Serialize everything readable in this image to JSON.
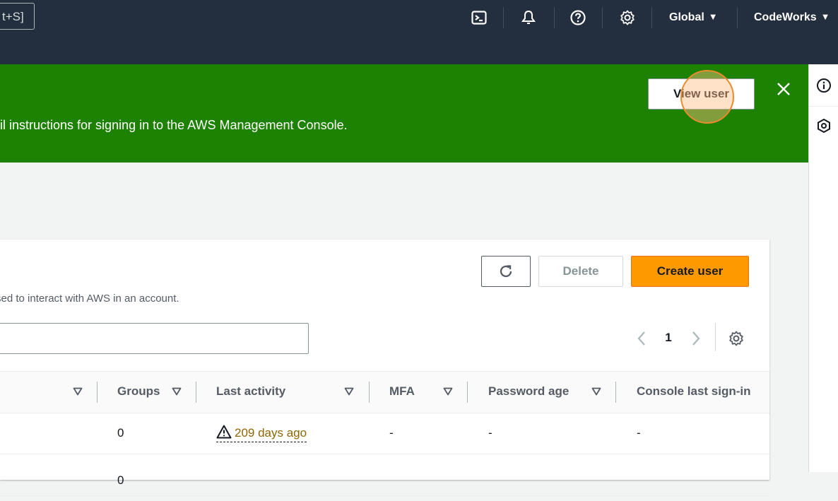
{
  "topnav": {
    "shortcut_hint": "t+S]",
    "icons": [
      "cloudshell-icon",
      "bell-icon",
      "help-icon",
      "settings-icon"
    ],
    "region": "Global",
    "account": "CodeWorks"
  },
  "flash": {
    "message": "ail instructions for signing in to the AWS Management Console.",
    "view_user_label": "View user",
    "color": "#1d8102"
  },
  "rail": {
    "icons": [
      "info-icon",
      "hexagon-icon"
    ]
  },
  "panel": {
    "description": "sed to interact with AWS in an account.",
    "delete_label": "Delete",
    "create_label": "Create user",
    "search_value": "",
    "page_number": "1",
    "accent": "#ff9900"
  },
  "table": {
    "columns": [
      "Groups",
      "Last activity",
      "MFA",
      "Password age",
      "Console last sign-in"
    ],
    "rows": [
      {
        "groups": "0",
        "last_activity": "209 days ago",
        "mfa": "-",
        "password_age": "-",
        "console_last_sign_in": "-"
      },
      {
        "groups": "0",
        "last_activity": "",
        "mfa": "",
        "password_age": "",
        "console_last_sign_in": ""
      }
    ]
  }
}
